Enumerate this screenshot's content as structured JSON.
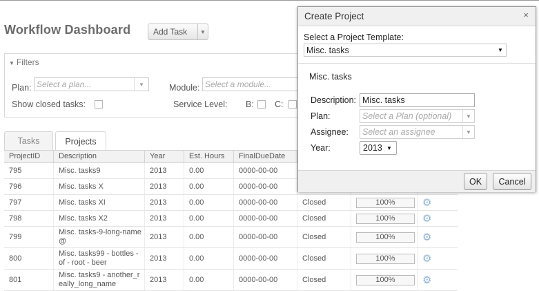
{
  "page": {
    "title": "Workflow Dashboard",
    "add_task_label": "Add Task"
  },
  "filters": {
    "header": "Filters",
    "plan_label": "Plan:",
    "plan_placeholder": "Select a plan...",
    "module_label": "Module:",
    "module_placeholder": "Select a module...",
    "show_closed_label": "Show closed tasks:",
    "service_level_label": "Service Level:",
    "b_label": "B:",
    "c_label": "C:"
  },
  "tabs": [
    {
      "label": "Tasks"
    },
    {
      "label": "Projects"
    }
  ],
  "grid": {
    "columns": [
      "ProjectID",
      "Description",
      "Year",
      "Est. Hours",
      "FinalDueDate"
    ],
    "rows": [
      {
        "id": "795",
        "description": "Misc. tasks9",
        "year": "2013",
        "hours": "0.00",
        "due": "0000-00-00",
        "status": "",
        "progress": ""
      },
      {
        "id": "796",
        "description": "Misc. tasks X",
        "year": "2013",
        "hours": "0.00",
        "due": "0000-00-00",
        "status": "",
        "progress": ""
      },
      {
        "id": "797",
        "description": "Misc. tasks XI",
        "year": "2013",
        "hours": "0.00",
        "due": "0000-00-00",
        "status": "Closed",
        "progress": "100%"
      },
      {
        "id": "798",
        "description": "Misc. tasks X2",
        "year": "2013",
        "hours": "0.00",
        "due": "0000-00-00",
        "status": "Closed",
        "progress": "100%"
      },
      {
        "id": "799",
        "description": "Misc. tasks-9-long-name @",
        "year": "2013",
        "hours": "0.00",
        "due": "0000-00-00",
        "status": "Closed",
        "progress": "100%"
      },
      {
        "id": "800",
        "description": "Misc. tasks99 - bottles - of - root - beer",
        "year": "2013",
        "hours": "0.00",
        "due": "0000-00-00",
        "status": "Closed",
        "progress": "100%"
      },
      {
        "id": "801",
        "description": "Misc. tasks9 - another_really_long_name",
        "year": "2013",
        "hours": "0.00",
        "due": "0000-00-00",
        "status": "Closed",
        "progress": "100%"
      }
    ]
  },
  "dialog": {
    "title": "Create Project",
    "close_glyph": "×",
    "template_label": "Select a Project Template:",
    "template_value": "Misc. tasks",
    "template_name": "Misc. tasks",
    "description_label": "Description:",
    "description_value": "Misc. tasks",
    "plan_label": "Plan:",
    "plan_placeholder": "Select a Plan (optional)",
    "assignee_label": "Assignee:",
    "assignee_placeholder": "Select an assignee",
    "year_label": "Year:",
    "year_value": "2013",
    "ok_label": "OK",
    "cancel_label": "Cancel"
  },
  "icons": {
    "gear": "gear-icon",
    "dropdown": "chevron-down-icon",
    "collapse": "triangle-down-icon"
  }
}
